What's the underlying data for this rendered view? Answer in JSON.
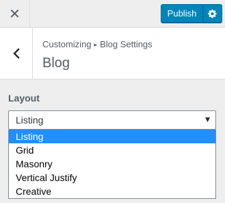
{
  "topbar": {
    "close_icon": "close-icon",
    "publish_label": "Publish",
    "settings_icon": "gear-icon",
    "accent_color": "#0085ba"
  },
  "header": {
    "back_icon": "chevron-left-icon",
    "breadcrumb_root": "Customizing",
    "breadcrumb_separator_icon": "triangle-right-icon",
    "breadcrumb_current": "Blog Settings",
    "title": "Blog"
  },
  "layout": {
    "label": "Layout",
    "selected": "Listing",
    "options": [
      "Listing",
      "Grid",
      "Masonry",
      "Vertical Justify",
      "Creative"
    ],
    "highlight_color": "#1e90ff"
  }
}
